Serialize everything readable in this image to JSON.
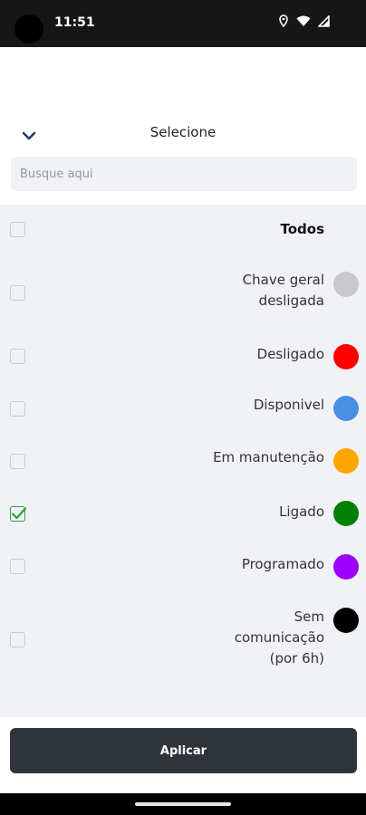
{
  "status_bar": {
    "time": "11:51"
  },
  "header": {
    "title": "Selecione"
  },
  "search": {
    "placeholder": "Busque aqui",
    "value": ""
  },
  "options": [
    {
      "label": "Todos",
      "checked": false,
      "bold": true
    },
    {
      "label": "Chave geral desligada",
      "color": "#c8c9cd",
      "checked": false
    },
    {
      "label": "Desligado",
      "color": "#ff0000",
      "checked": false
    },
    {
      "label": "Disponivel",
      "color": "#4a90e2",
      "checked": false
    },
    {
      "label": "Em manutenção",
      "color": "#ffa500",
      "checked": false
    },
    {
      "label": "Ligado",
      "color": "#008000",
      "checked": true
    },
    {
      "label": "Programado",
      "color": "#9b00ff",
      "checked": false
    },
    {
      "label": "Sem comunicação (por 6h)",
      "color": "#000000",
      "checked": false
    }
  ],
  "footer": {
    "apply_label": "Aplicar"
  }
}
